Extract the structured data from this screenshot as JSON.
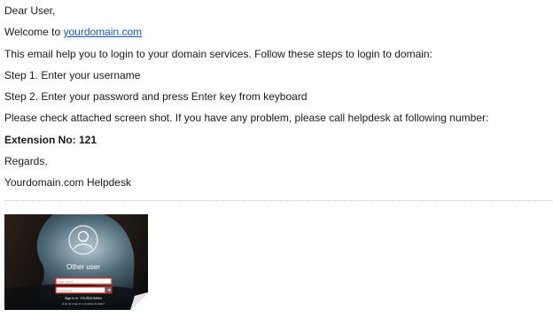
{
  "email": {
    "greeting": "Dear User,",
    "welcome_prefix": "Welcome to ",
    "welcome_link": "yourdomain.com",
    "intro": "This email help you to login to your domain services. Follow these steps to login to domain:",
    "step1": "Step 1. Enter your username",
    "step2": "Step 2. Enter your password and press Enter key from keyboard",
    "check": "Please check attached screen shot. If you have any problem, please call helpdesk at following number:",
    "extension": "Extension No: 121",
    "regards": "Regards,",
    "signature": "Yourdomain.com Helpdesk"
  },
  "attachment": {
    "user_label": "Other user",
    "username_placeholder": "User name",
    "password_placeholder": "Password",
    "signin_text": "Sign in to: YOURDOMAIN",
    "help_text": "How do I sign in to another domain?",
    "highlight_color": "#d9261c",
    "link_color": "#1155cc"
  }
}
